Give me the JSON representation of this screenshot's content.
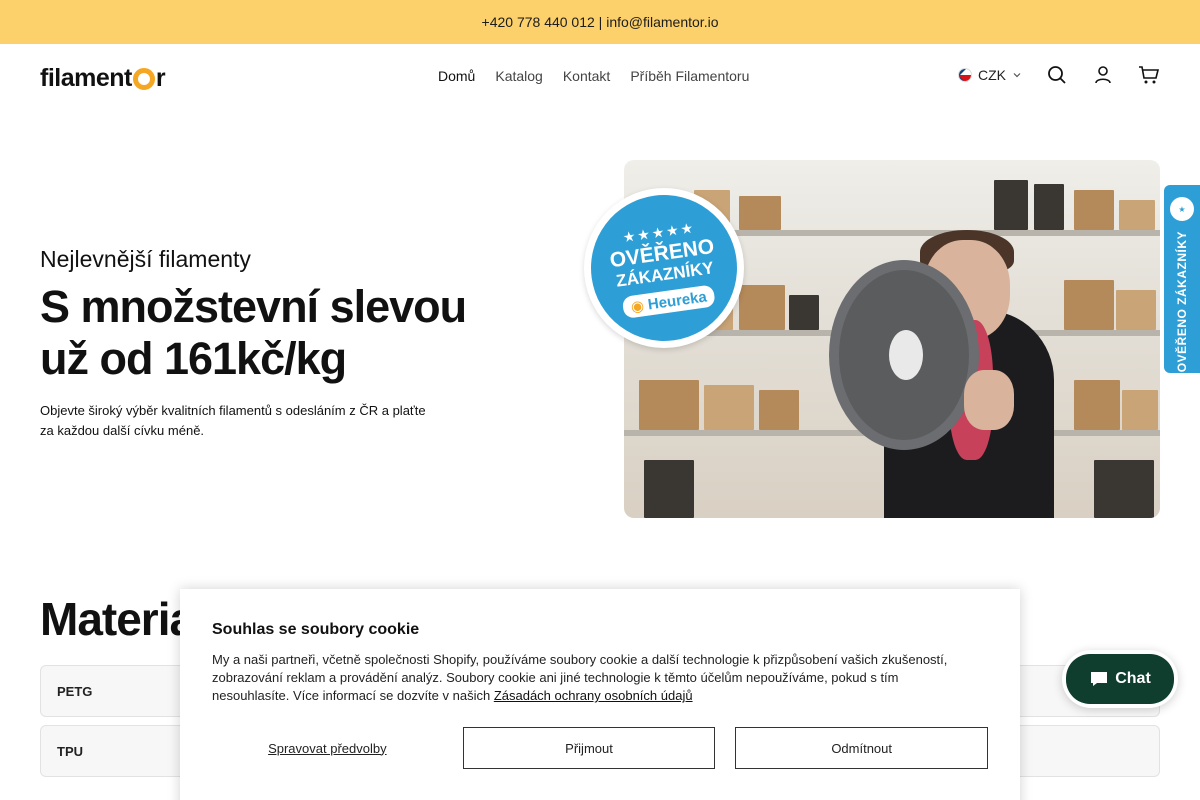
{
  "announcement": {
    "text": "+420 778 440 012 | info@filamentor.io"
  },
  "header": {
    "logo_left": "filament",
    "logo_right": "r",
    "nav": [
      {
        "label": "Domů",
        "active": true
      },
      {
        "label": "Katalog"
      },
      {
        "label": "Kontakt"
      },
      {
        "label": "Příběh Filamentoru"
      }
    ],
    "currency": "CZK",
    "icons": [
      "search-icon",
      "account-icon",
      "cart-icon"
    ]
  },
  "hero": {
    "subtitle": "Nejlevnější filamenty",
    "title_line1": "S množstevní slevou",
    "title_line2": "už od 161kč/kg",
    "description": "Objevte široký výběr kvalitních filamentů s odesláním z ČR a plaťte za každou další cívku méně."
  },
  "heureka_badge": {
    "line1": "OVĚŘENO",
    "line2": "ZÁKAZNÍKY",
    "brand": "Heureka"
  },
  "side_badge": {
    "text": "OVĚŘENO ZÁKAZNÍKY"
  },
  "materials": {
    "title": "Materiály",
    "title_visible": "Materia",
    "rows": [
      "PETG",
      "TPU"
    ]
  },
  "cookie": {
    "title": "Souhlas se soubory cookie",
    "text": "My a naši partneři, včetně společnosti Shopify, používáme soubory cookie a další technologie k přizpůsobení vašich zkušeností, zobrazování reklam a provádění analýz. Soubory cookie ani jiné technologie k těmto účelům nepoužíváme, pokud s tím nesouhlasíte. Více informací se dozvíte v našich ",
    "link": "Zásadách ochrany osobních údajů",
    "manage": "Spravovat předvolby",
    "accept": "Přijmout",
    "decline": "Odmítnout"
  },
  "chat": {
    "label": "Chat"
  },
  "colors": {
    "accent": "#fcd06a",
    "heureka": "#2e9fd6",
    "chat": "#0f3d2e"
  }
}
